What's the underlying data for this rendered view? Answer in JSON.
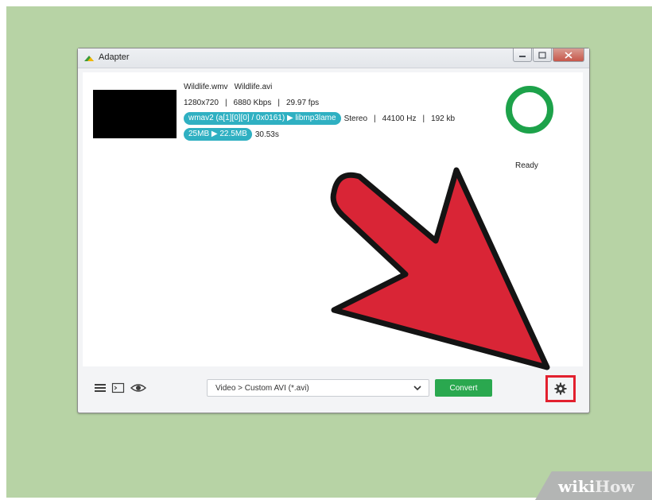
{
  "window": {
    "title": "Adapter",
    "controls": [
      "minimize",
      "restore",
      "close"
    ]
  },
  "file": {
    "source_name": "Wildlife.wmv",
    "target_name": "Wildlife.avi",
    "resolution": "1280x720",
    "bitrate": "6880 Kbps",
    "fps": "29.97 fps",
    "audio_codec_change": "wmav2 (a[1][0][0] / 0x0161) ▶ libmp3lame",
    "audio_channels": "Stereo",
    "sample_rate": "44100 Hz",
    "audio_bitrate": "192 kb",
    "size_change": "25MB ▶ 22.5MB",
    "duration": "30.53s",
    "separator": "|"
  },
  "status": {
    "label": "Ready",
    "ring_color": "#1da24a"
  },
  "toolbar": {
    "icons": [
      "menu-icon",
      "terminal-icon",
      "eye-icon"
    ],
    "format_value": "Video > Custom AVI (*.avi)",
    "convert_label": "Convert",
    "settings_icon": "gear-icon"
  },
  "annotation": {
    "arrow_color": "#d92536",
    "highlight_color": "#e2202e"
  },
  "watermark": {
    "part1": "wiki",
    "part2": "How"
  },
  "colors": {
    "background": "#b7d3a5",
    "accent_teal": "#2fb0c2",
    "convert_green": "#2aa84f"
  }
}
